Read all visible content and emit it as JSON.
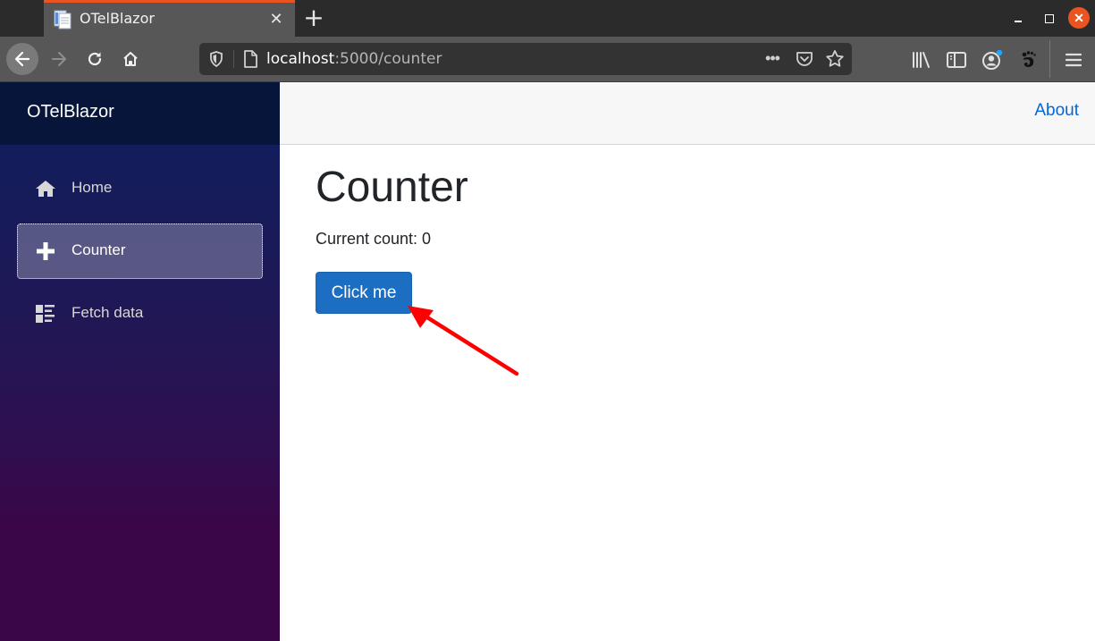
{
  "browser": {
    "tab": {
      "title": "OTelBlazor",
      "close_glyph": "✕"
    },
    "new_tab_glyph": "+",
    "window_controls": {
      "close_glyph": "✕"
    },
    "url": {
      "host": "localhost",
      "rest": ":5000/counter"
    },
    "url_more_glyph": "•••",
    "accent_color": "#e95420"
  },
  "app": {
    "brand": "OTelBlazor",
    "sidebar": {
      "items": [
        {
          "label": "Home",
          "icon": "home-icon",
          "active": false
        },
        {
          "label": "Counter",
          "icon": "plus-icon",
          "active": true
        },
        {
          "label": "Fetch data",
          "icon": "list-icon",
          "active": false
        }
      ]
    },
    "top_row": {
      "about_label": "About"
    },
    "main": {
      "title": "Counter",
      "count_text": "Current count: 0",
      "button_label": "Click me"
    },
    "colors": {
      "primary_button": "#1b6ec2",
      "link": "#0366d6",
      "annotation_arrow": "#ff0000"
    }
  }
}
